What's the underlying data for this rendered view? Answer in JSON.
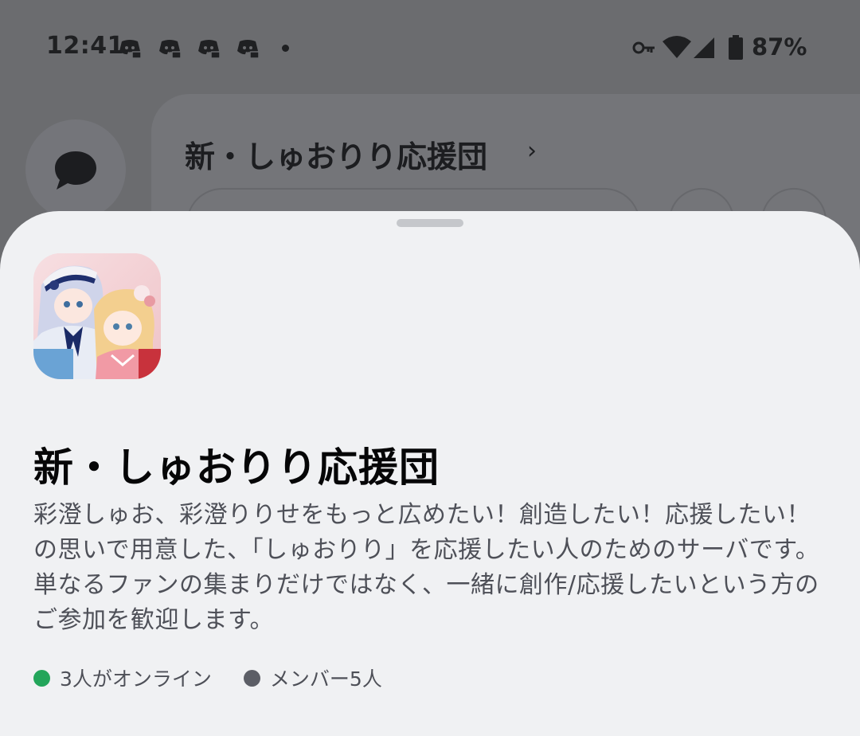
{
  "status_bar": {
    "time": "12:41",
    "battery": "87%",
    "notification_icons": [
      "discord-icon",
      "discord-icon",
      "discord-icon",
      "discord-icon"
    ]
  },
  "background": {
    "server_title": "新・しゅおりり応援団",
    "chevron": "›"
  },
  "sheet": {
    "server_name": "新・しゅおりり応援団",
    "description": "彩澄しゅお、彩澄りりせをもっと広めたい！創造したい！応援したい！の思いで用意した、「しゅおりり」を応援したい人のためのサーバです。単なるファンの集まりだけではなく、一緒に創作/応援したいという方のご参加を歓迎します。",
    "online_text": "3人がオンライン",
    "members_text": "メンバー5人",
    "colors": {
      "online": "#23a55a",
      "members": "#5c5e66"
    }
  }
}
